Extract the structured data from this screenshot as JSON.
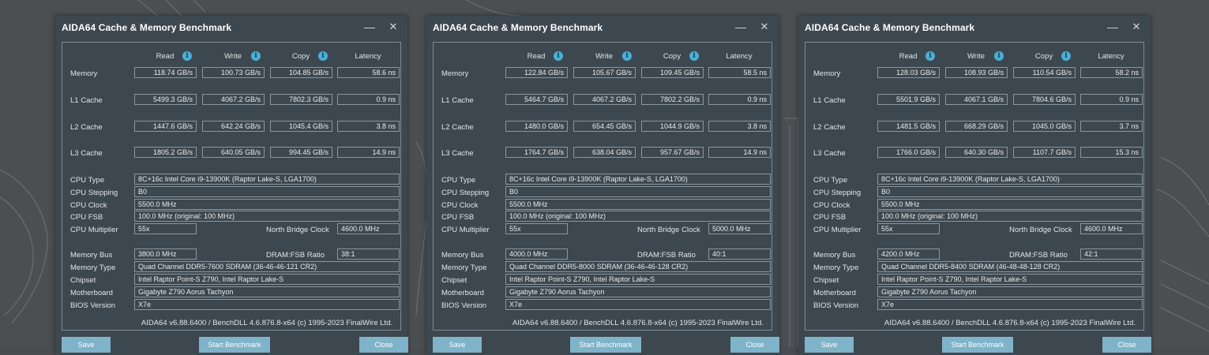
{
  "headers": {
    "read": "Read",
    "write": "Write",
    "copy": "Copy",
    "latency": "Latency"
  },
  "row_labels": {
    "memory": "Memory",
    "l1": "L1 Cache",
    "l2": "L2 Cache",
    "l3": "L3 Cache",
    "cpu_type": "CPU Type",
    "cpu_stepping": "CPU Stepping",
    "cpu_clock": "CPU Clock",
    "cpu_fsb": "CPU FSB",
    "cpu_multiplier": "CPU Multiplier",
    "nb_clock": "North Bridge Clock",
    "memory_bus": "Memory Bus",
    "dram_fsb": "DRAM:FSB Ratio",
    "memory_type": "Memory Type",
    "chipset": "Chipset",
    "motherboard": "Motherboard",
    "bios": "BIOS Version"
  },
  "buttons": {
    "save": "Save",
    "start": "Start Benchmark",
    "close": "Close"
  },
  "icons": {
    "info": "info-icon",
    "minimize": "minimize-icon",
    "close": "close-icon"
  },
  "colors": {
    "window_bg": "#3d474f",
    "button": "#7fb3c9",
    "info": "#49b1d6"
  },
  "windows": [
    {
      "title": "AIDA64 Cache & Memory Benchmark",
      "minimize_glyph": "—",
      "close_glyph": "✕",
      "memory": {
        "read": "118.74 GB/s",
        "write": "100.73 GB/s",
        "copy": "104.85 GB/s",
        "latency": "58.6 ns"
      },
      "l1": {
        "read": "5499.3 GB/s",
        "write": "4067.2 GB/s",
        "copy": "7802.3 GB/s",
        "latency": "0.9 ns"
      },
      "l2": {
        "read": "1447.6 GB/s",
        "write": "642.24 GB/s",
        "copy": "1045.4 GB/s",
        "latency": "3.8 ns"
      },
      "l3": {
        "read": "1805.2 GB/s",
        "write": "640.05 GB/s",
        "copy": "994.45 GB/s",
        "latency": "14.9 ns"
      },
      "cpu_type": "8C+16c Intel Core i9-13900K  (Raptor Lake-S, LGA1700)",
      "cpu_stepping": "B0",
      "cpu_clock": "5500.0 MHz",
      "cpu_fsb": "100.0 MHz  (original: 100 MHz)",
      "cpu_multiplier": "55x",
      "nb_clock": "4600.0 MHz",
      "memory_bus": "3800.0 MHz",
      "dram_fsb": "38:1",
      "memory_type": "Quad Channel DDR5-7600 SDRAM  (36-46-46-121 CR2)",
      "chipset": "Intel Raptor Point-S Z790, Intel Raptor Lake-S",
      "motherboard": "Gigabyte Z790 Aorus Tachyon",
      "bios": "X7e",
      "footer": "AIDA64 v6.88.6400 / BenchDLL 4.6.876.8-x64  (c) 1995-2023 FinalWire Ltd."
    },
    {
      "title": "AIDA64 Cache & Memory Benchmark",
      "minimize_glyph": "—",
      "close_glyph": "✕",
      "memory": {
        "read": "122.84 GB/s",
        "write": "105.67 GB/s",
        "copy": "109.45 GB/s",
        "latency": "58.5 ns"
      },
      "l1": {
        "read": "5464.7 GB/s",
        "write": "4067.2 GB/s",
        "copy": "7802.2 GB/s",
        "latency": "0.9 ns"
      },
      "l2": {
        "read": "1480.0 GB/s",
        "write": "654.45 GB/s",
        "copy": "1044.9 GB/s",
        "latency": "3.8 ns"
      },
      "l3": {
        "read": "1764.7 GB/s",
        "write": "638.04 GB/s",
        "copy": "957.67 GB/s",
        "latency": "14.9 ns"
      },
      "cpu_type": "8C+16c Intel Core i9-13900K  (Raptor Lake-S, LGA1700)",
      "cpu_stepping": "B0",
      "cpu_clock": "5500.0 MHz",
      "cpu_fsb": "100.0 MHz  (original: 100 MHz)",
      "cpu_multiplier": "55x",
      "nb_clock": "5000.0 MHz",
      "memory_bus": "4000.0 MHz",
      "dram_fsb": "40:1",
      "memory_type": "Quad Channel DDR5-8000 SDRAM  (36-46-46-128 CR2)",
      "chipset": "Intel Raptor Point-S Z790, Intel Raptor Lake-S",
      "motherboard": "Gigabyte Z790 Aorus Tachyon",
      "bios": "X7e",
      "footer": "AIDA64 v6.88.6400 / BenchDLL 4.6.876.8-x64  (c) 1995-2023 FinalWire Ltd."
    },
    {
      "title": "AIDA64 Cache & Memory Benchmark",
      "minimize_glyph": "—",
      "close_glyph": "✕",
      "memory": {
        "read": "128.03 GB/s",
        "write": "108.93 GB/s",
        "copy": "110.54 GB/s",
        "latency": "58.2 ns"
      },
      "l1": {
        "read": "5501.9 GB/s",
        "write": "4067.1 GB/s",
        "copy": "7804.6 GB/s",
        "latency": "0.9 ns"
      },
      "l2": {
        "read": "1481.5 GB/s",
        "write": "668.29 GB/s",
        "copy": "1045.0 GB/s",
        "latency": "3.7 ns"
      },
      "l3": {
        "read": "1766.0 GB/s",
        "write": "640.30 GB/s",
        "copy": "1107.7 GB/s",
        "latency": "15.3 ns"
      },
      "cpu_type": "8C+16c Intel Core i9-13900K  (Raptor Lake-S, LGA1700)",
      "cpu_stepping": "B0",
      "cpu_clock": "5500.0 MHz",
      "cpu_fsb": "100.0 MHz  (original: 100 MHz)",
      "cpu_multiplier": "55x",
      "nb_clock": "4600.0 MHz",
      "memory_bus": "4200.0 MHz",
      "dram_fsb": "42:1",
      "memory_type": "Quad Channel DDR5-8400 SDRAM  (46-48-48-128 CR2)",
      "chipset": "Intel Raptor Point-S Z790, Intel Raptor Lake-S",
      "motherboard": "Gigabyte Z790 Aorus Tachyon",
      "bios": "X7e",
      "footer": "AIDA64 v6.88.6400 / BenchDLL 4.6.876.8-x64  (c) 1995-2023 FinalWire Ltd."
    }
  ]
}
